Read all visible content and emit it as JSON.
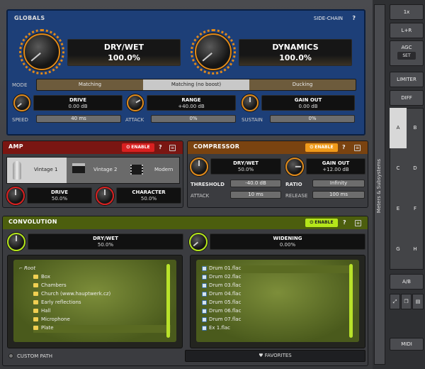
{
  "globals": {
    "title": "GLOBALS",
    "sidechain": "SIDE-CHAIN",
    "help": "?",
    "drywet": {
      "label": "DRY/WET",
      "value": "100.0%"
    },
    "dynamics": {
      "label": "DYNAMICS",
      "value": "100.0%"
    },
    "mode": {
      "label": "MODE",
      "options": [
        "Matching",
        "Matching (no boost)",
        "Ducking"
      ],
      "selected": "Matching (no boost)"
    },
    "drive": {
      "label": "DRIVE",
      "value": "0.00 dB"
    },
    "range": {
      "label": "RANGE",
      "value": "+40.00 dB"
    },
    "gainout": {
      "label": "GAIN OUT",
      "value": "0.00 dB"
    },
    "speed": {
      "label": "SPEED",
      "value": "40 ms"
    },
    "attack": {
      "label": "ATTACK",
      "value": "0%"
    },
    "sustain": {
      "label": "SUSTAIN",
      "value": "0%"
    }
  },
  "amp": {
    "title": "AMP",
    "enable": "ENABLE",
    "help": "?",
    "types": [
      "Vintage 1",
      "Vintage 2",
      "Modern"
    ],
    "drive": {
      "label": "DRIVE",
      "value": "50.0%"
    },
    "character": {
      "label": "CHARACTER",
      "value": "50.0%"
    }
  },
  "compressor": {
    "title": "COMPRESSOR",
    "enable": "ENABLE",
    "help": "?",
    "drywet": {
      "label": "DRY/WET",
      "value": "50.0%"
    },
    "gainout": {
      "label": "GAIN OUT",
      "value": "+12.00 dB"
    },
    "threshold": {
      "label": "THRESHOLD",
      "value": "-40.0 dB"
    },
    "ratio": {
      "label": "RATIO",
      "value": "Infinity"
    },
    "attack": {
      "label": "ATTACK",
      "value": "10 ms"
    },
    "release": {
      "label": "RELEASE",
      "value": "100 ms"
    }
  },
  "convolution": {
    "title": "CONVOLUTION",
    "enable": "ENABLE",
    "help": "?",
    "drywet": {
      "label": "DRY/WET",
      "value": "50.0%"
    },
    "widening": {
      "label": "WIDENING",
      "value": "0.00%"
    },
    "tree": [
      "Root",
      "Box",
      "Chambers",
      "Church (www.hauptwerk.cz)",
      "Early reflections",
      "Hall",
      "Microphone",
      "Plate"
    ],
    "files": [
      "Drum 01.flac",
      "Drum 02.flac",
      "Drum 03.flac",
      "Drum 04.flac",
      "Drum 05.flac",
      "Drum 06.flac",
      "Drum 07.flac",
      "Ex 1.flac"
    ],
    "custom_path": "CUSTOM PATH",
    "favorites": "FAVORITES"
  },
  "side": {
    "b1x": "1x",
    "blr": "L+R",
    "bagc": "AGC",
    "bset": "SET",
    "blimiter": "LIMITER",
    "bdiff": "DIFF",
    "meters": "Meters & Subsystems",
    "ab": [
      "A",
      "B",
      "C",
      "D",
      "E",
      "F",
      "G",
      "H"
    ],
    "abbtn": "A/B",
    "midi": "MIDI"
  },
  "colors": {
    "globals_blue": "#1d3f78",
    "amp_red": "#7a1612",
    "comp_orange": "#7a4310",
    "conv_green": "#4c5e0e",
    "knob_ring": "#e0891a",
    "enable_red": "#d92020",
    "enable_orange": "#f09a1a",
    "enable_green": "#b5e61a"
  }
}
